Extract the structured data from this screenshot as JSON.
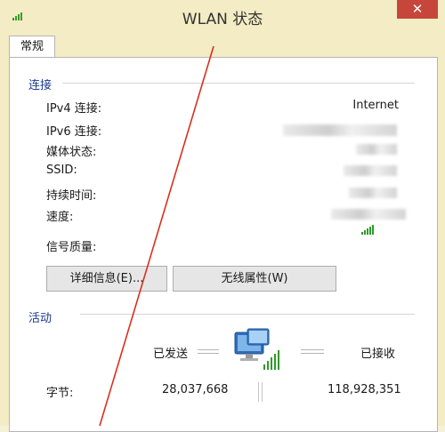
{
  "window": {
    "title": "WLAN 状态",
    "close_glyph": "✕"
  },
  "tabs": [
    {
      "label": "常规"
    }
  ],
  "connection": {
    "title": "连接",
    "rows": [
      {
        "label": "IPv4 连接:",
        "value": "Internet"
      },
      {
        "label": "IPv6 连接:",
        "value": ""
      },
      {
        "label": "媒体状态:",
        "value": ""
      },
      {
        "label": "SSID:",
        "value": ""
      },
      {
        "label": "持续时间:",
        "value": ""
      },
      {
        "label": "速度:",
        "value": ""
      },
      {
        "label": "信号质量:",
        "value": ""
      }
    ],
    "signal_icon": "signal-bars-icon"
  },
  "buttons": {
    "details": "详细信息(E)...",
    "wireless_props": "无线属性(W)"
  },
  "activity": {
    "title": "活动",
    "sent_label": "已发送",
    "received_label": "已接收",
    "bytes_label": "字节:",
    "bytes_sent": "28,037,668",
    "bytes_received": "118,928,351",
    "network_icon": "network-computers-icon"
  },
  "colors": {
    "accent": "#1b3a8a",
    "close": "#c7463b",
    "annotation": "#d9301e"
  }
}
